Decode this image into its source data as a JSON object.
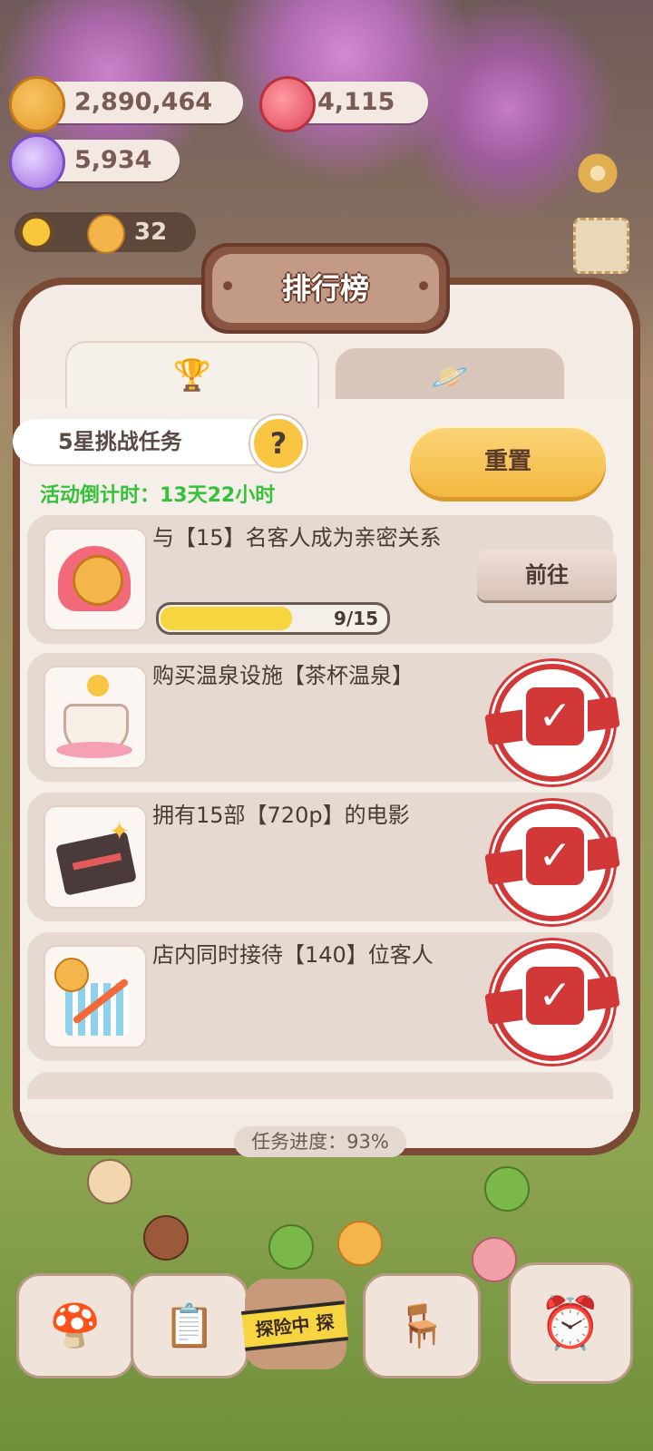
{
  "resources": {
    "cookies": "2,890,464",
    "hearts": "4,115",
    "gems": "5,934",
    "sun_count": "32"
  },
  "panel": {
    "title": "排行榜",
    "tabs": [
      {
        "icon": "trophy-icon",
        "glyph": "🏆",
        "active": true
      },
      {
        "icon": "planet-icon",
        "glyph": "🪐",
        "active": false
      }
    ]
  },
  "challenge": {
    "label": "5星挑战任务",
    "help_glyph": "?",
    "countdown": "活动倒计时：13天22小时",
    "reset_label": "重置"
  },
  "tasks": [
    {
      "text": "与【15】名客人成为亲密关系",
      "icon": "heart-cookie-icon",
      "progress_text": "9/15",
      "progress": 0.6,
      "status": "in-progress",
      "action_label": "前往"
    },
    {
      "text": "购买温泉设施【茶杯温泉】",
      "icon": "teacup-spring-icon",
      "status": "done"
    },
    {
      "text": "拥有15部【720p】的电影",
      "icon": "clapperboard-icon",
      "status": "done"
    },
    {
      "text": "店内同时接待【140】位客人",
      "icon": "growth-chart-icon",
      "status": "done"
    }
  ],
  "task_progress": "任务进度：93%",
  "bottom_nav": {
    "explore_tape": "探险中 探"
  },
  "colors": {
    "accent_yellow": "#f3b83e",
    "countdown_green": "#34c23a",
    "seal_red": "#d33838",
    "panel_frame": "#7a4a34"
  }
}
